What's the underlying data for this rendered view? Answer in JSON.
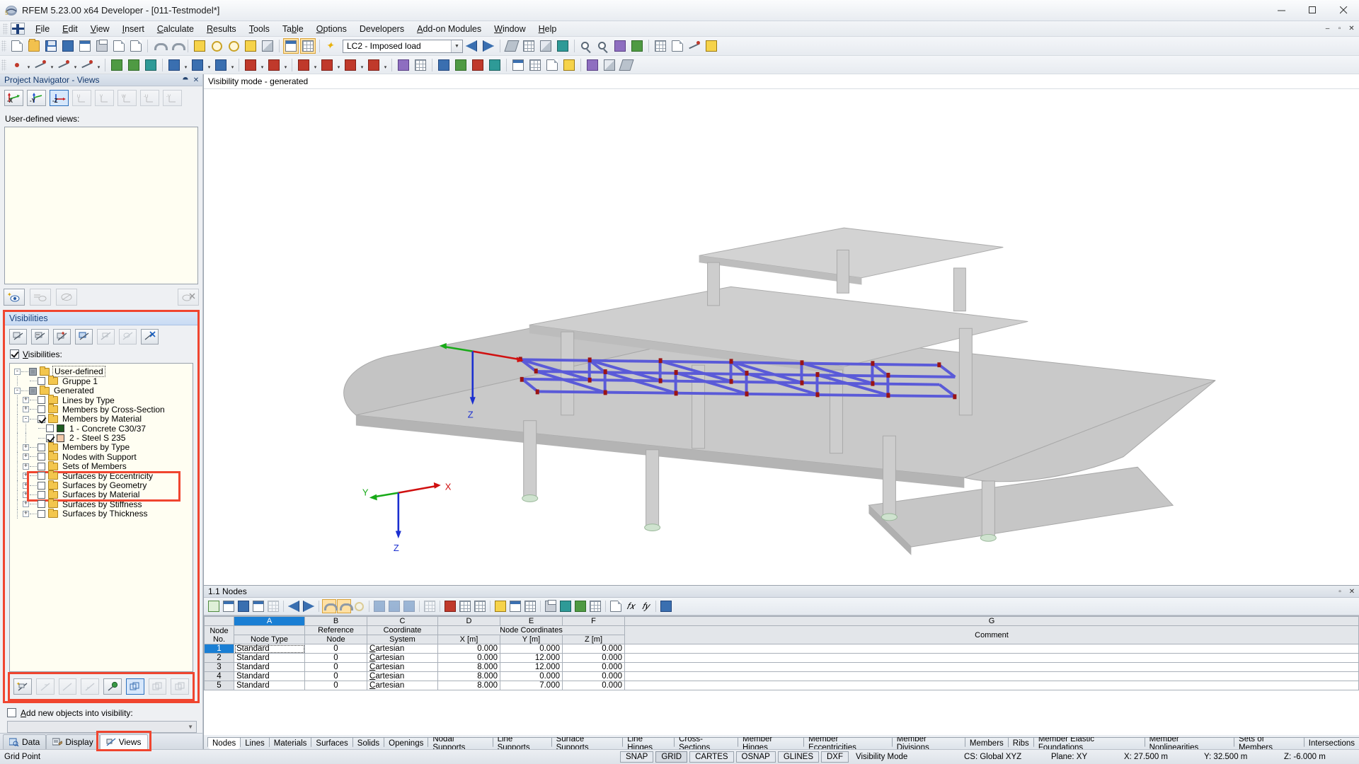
{
  "window": {
    "title": "RFEM 5.23.00 x64 Developer - [011-Testmodel*]",
    "minimize": "–",
    "maximize": "▢",
    "close": "✕",
    "inner_minimize": "–",
    "inner_restore": "▫",
    "inner_close": "✕"
  },
  "menu": {
    "items": [
      {
        "label": "File",
        "accel": "F"
      },
      {
        "label": "Edit",
        "accel": "E"
      },
      {
        "label": "View",
        "accel": "V"
      },
      {
        "label": "Insert",
        "accel": "I"
      },
      {
        "label": "Calculate",
        "accel": "C"
      },
      {
        "label": "Results",
        "accel": "R"
      },
      {
        "label": "Tools",
        "accel": "T"
      },
      {
        "label": "Table",
        "accel": "b"
      },
      {
        "label": "Options",
        "accel": "O"
      },
      {
        "label": "Developers",
        "accel": ""
      },
      {
        "label": "Add-on Modules",
        "accel": "A"
      },
      {
        "label": "Window",
        "accel": "W"
      },
      {
        "label": "Help",
        "accel": "H"
      }
    ]
  },
  "toolbar": {
    "load_case": "LC2 - Imposed load"
  },
  "navigator": {
    "title": "Project Navigator - Views",
    "view_buttons": [
      "-X",
      "-Y",
      "-Z",
      "U",
      "V",
      "W",
      "-U",
      "-V"
    ],
    "user_defined_label": "User-defined views:",
    "visibilities": {
      "title": "Visibilities",
      "checkbox_label": "Visibilities:",
      "checked": true,
      "tree": [
        {
          "label": "User-defined",
          "level": 0,
          "state": "grey",
          "expander": "-",
          "folder": true,
          "selected": true
        },
        {
          "label": "Gruppe 1",
          "level": 1,
          "state": "off",
          "expander": "",
          "folder": true
        },
        {
          "label": "Generated",
          "level": 0,
          "state": "grey",
          "expander": "-",
          "folder": true
        },
        {
          "label": "Lines by Type",
          "level": 1,
          "state": "off",
          "expander": "+",
          "folder": true
        },
        {
          "label": "Members by Cross-Section",
          "level": 1,
          "state": "off",
          "expander": "+",
          "folder": true
        },
        {
          "label": "Members by Material",
          "level": 1,
          "state": "on",
          "expander": "-",
          "folder": true,
          "highlight": true
        },
        {
          "label": "1 - Concrete C30/37",
          "level": 2,
          "state": "off",
          "expander": "",
          "swatch": "#1f5c1f",
          "highlight": true
        },
        {
          "label": "2 - Steel S 235",
          "level": 2,
          "state": "on",
          "expander": "",
          "swatch": "#f3c9a8",
          "highlight": true
        },
        {
          "label": "Members by Type",
          "level": 1,
          "state": "off",
          "expander": "+",
          "folder": true
        },
        {
          "label": "Nodes with Support",
          "level": 1,
          "state": "off",
          "expander": "+",
          "folder": true
        },
        {
          "label": "Sets of Members",
          "level": 1,
          "state": "off",
          "expander": "+",
          "folder": true
        },
        {
          "label": "Surfaces by Eccentricity",
          "level": 1,
          "state": "off",
          "expander": "+",
          "folder": true
        },
        {
          "label": "Surfaces by Geometry",
          "level": 1,
          "state": "off",
          "expander": "+",
          "folder": true
        },
        {
          "label": "Surfaces by Material",
          "level": 1,
          "state": "off",
          "expander": "+",
          "folder": true
        },
        {
          "label": "Surfaces by Stiffness",
          "level": 1,
          "state": "off",
          "expander": "+",
          "folder": true
        },
        {
          "label": "Surfaces by Thickness",
          "level": 1,
          "state": "off",
          "expander": "+",
          "folder": true
        }
      ]
    },
    "add_new_label": "Add new objects into visibility:",
    "add_new_value": "",
    "tabs": [
      {
        "label": "Data",
        "icon": "data-icon",
        "active": false
      },
      {
        "label": "Display",
        "icon": "display-icon",
        "active": false
      },
      {
        "label": "Views",
        "icon": "views-icon",
        "active": true
      }
    ]
  },
  "viewport": {
    "mode_label": "Visibility mode - generated",
    "axis": {
      "x": "X",
      "y": "Y",
      "z": "Z"
    },
    "model_axis": {
      "x": "X",
      "y": "Y",
      "z": "Z"
    }
  },
  "table": {
    "title": "1.1 Nodes",
    "column_letters": [
      "A",
      "B",
      "C",
      "D",
      "E",
      "F",
      "G"
    ],
    "selected_column": "A",
    "header_rowno": "Node\nNo.",
    "header_rowno_line1": "Node",
    "header_rowno_line2": "No.",
    "group_header": "Node Coordinates",
    "headers": [
      {
        "line1": "",
        "line2": "Node Type"
      },
      {
        "line1": "Reference",
        "line2": "Node"
      },
      {
        "line1": "Coordinate",
        "line2": "System"
      },
      {
        "line1": "",
        "line2": "X [m]"
      },
      {
        "line1": "",
        "line2": "Y [m]"
      },
      {
        "line1": "",
        "line2": "Z [m]"
      },
      {
        "line1": "",
        "line2": "Comment"
      }
    ],
    "rows": [
      {
        "no": "1",
        "type": "Standard",
        "ref": "0",
        "cs": "Cartesian",
        "x": "0.000",
        "y": "0.000",
        "z": "0.000",
        "comment": "",
        "selected": true
      },
      {
        "no": "2",
        "type": "Standard",
        "ref": "0",
        "cs": "Cartesian",
        "x": "0.000",
        "y": "12.000",
        "z": "0.000",
        "comment": ""
      },
      {
        "no": "3",
        "type": "Standard",
        "ref": "0",
        "cs": "Cartesian",
        "x": "8.000",
        "y": "12.000",
        "z": "0.000",
        "comment": ""
      },
      {
        "no": "4",
        "type": "Standard",
        "ref": "0",
        "cs": "Cartesian",
        "x": "8.000",
        "y": "0.000",
        "z": "0.000",
        "comment": ""
      },
      {
        "no": "5",
        "type": "Standard",
        "ref": "0",
        "cs": "Cartesian",
        "x": "8.000",
        "y": "7.000",
        "z": "0.000",
        "comment": ""
      }
    ],
    "tabs": [
      {
        "label": "Nodes",
        "active": true
      },
      {
        "label": "Lines",
        "active": false
      },
      {
        "label": "Materials",
        "active": false
      },
      {
        "label": "Surfaces",
        "active": false
      },
      {
        "label": "Solids",
        "active": false
      },
      {
        "label": "Openings",
        "active": false
      },
      {
        "label": "Nodal Supports",
        "active": false
      },
      {
        "label": "Line Supports",
        "active": false
      },
      {
        "label": "Surface Supports",
        "active": false
      },
      {
        "label": "Line Hinges",
        "active": false
      },
      {
        "label": "Cross-Sections",
        "active": false
      },
      {
        "label": "Member Hinges",
        "active": false
      },
      {
        "label": "Member Eccentricities",
        "active": false
      },
      {
        "label": "Member Divisions",
        "active": false
      },
      {
        "label": "Members",
        "active": false
      },
      {
        "label": "Ribs",
        "active": false
      },
      {
        "label": "Member Elastic Foundations",
        "active": false
      },
      {
        "label": "Member Nonlinearities",
        "active": false
      },
      {
        "label": "Sets of Members",
        "active": false
      },
      {
        "label": "Intersections",
        "active": false
      }
    ]
  },
  "status": {
    "left": "Grid Point",
    "snap": "SNAP",
    "grid": "GRID",
    "cartes": "CARTES",
    "osnap": "OSNAP",
    "glines": "GLINES",
    "dxf": "DXF",
    "visibility_mode": "Visibility Mode",
    "cs": "CS: Global XYZ",
    "plane": "Plane: XY",
    "x": "X:  27.500 m",
    "y": "Y:  32.500 m",
    "z": "Z:  -6.000 m"
  },
  "colors": {
    "accent_red": "#f0452f",
    "select_blue": "#1a7fd4",
    "truss_blue": "#6f6fe0",
    "concrete_grey": "#c8c8c8"
  }
}
